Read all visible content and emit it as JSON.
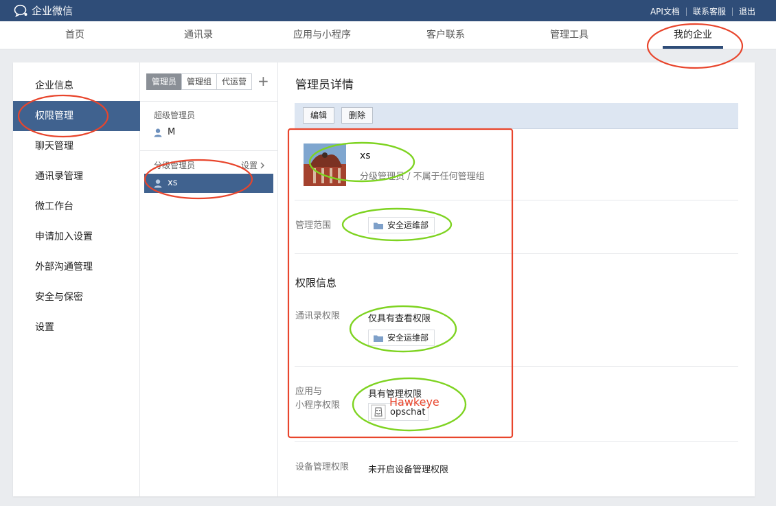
{
  "topbar": {
    "brand": "企业微信",
    "links": [
      "API文档",
      "联系客服",
      "退出"
    ]
  },
  "nav": {
    "tabs": [
      "首页",
      "通讯录",
      "应用与小程序",
      "客户联系",
      "管理工具",
      "我的企业"
    ],
    "active": "我的企业"
  },
  "sidebar": {
    "items": [
      "企业信息",
      "权限管理",
      "聊天管理",
      "通讯录管理",
      "微工作台",
      "申请加入设置",
      "外部沟通管理",
      "安全与保密",
      "设置"
    ],
    "active": "权限管理"
  },
  "admin_list": {
    "tabs": [
      "管理员",
      "管理组",
      "代运营"
    ],
    "active_tab": "管理员",
    "add_icon": "plus-icon",
    "super_label": "超级管理员",
    "super_admins": [
      "M"
    ],
    "sub_label": "分级管理员",
    "settings_link": "设置",
    "sub_admins": [
      "xs"
    ],
    "selected": "xs"
  },
  "detail": {
    "title": "管理员详情",
    "buttons": {
      "edit": "编辑",
      "delete": "删除"
    },
    "name": "xs",
    "subtitle": "分级管理员 / 不属于任何管理组",
    "scope_label": "管理范围",
    "scope_dept": "安全运维部",
    "perm_title": "权限信息",
    "contacts_label": "通讯录权限",
    "contacts_value": "仅具有查看权限",
    "contacts_dept": "安全运维部",
    "apps_label_1": "应用与",
    "apps_label_2": "小程序权限",
    "apps_value": "具有管理权限",
    "app_name": "opschat",
    "device_label": "设备管理权限",
    "device_value": "未开启设备管理权限"
  },
  "annotation": {
    "text": "Hawkeye",
    "red": "#e8452c",
    "green": "#7ed321"
  },
  "colors": {
    "topbar": "#2f4d78",
    "active_item": "#40628f",
    "toolbar": "#dde6f2"
  }
}
